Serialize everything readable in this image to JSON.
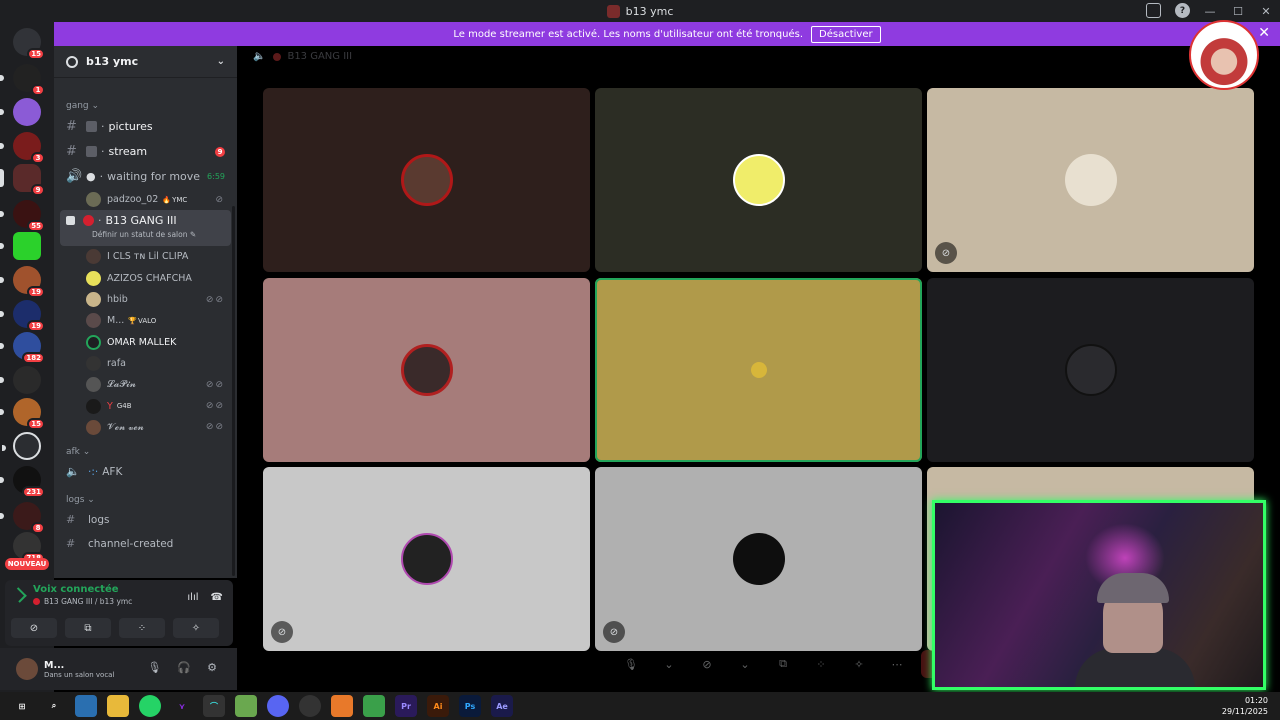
{
  "window": {
    "title": "b13 ymc"
  },
  "banner": {
    "message": "Le mode streamer est activé. Les noms d'utilisateur ont été tronqués.",
    "button_label": "Désactiver"
  },
  "rail": {
    "home_badge": "15",
    "badges": [
      "1",
      "",
      "3",
      "9",
      "55",
      "",
      "19",
      "19",
      "182",
      "",
      "15",
      "",
      "231",
      "8",
      "718"
    ],
    "nouveau_label": "NOUVEAU"
  },
  "sidebar": {
    "server_name": "b13 ymc",
    "category_gang": "gang",
    "channels": [
      {
        "name": "pictures"
      },
      {
        "name": "stream",
        "mention": "9"
      },
      {
        "name": "waiting for move",
        "timer": "6:59"
      }
    ],
    "waiting_member": {
      "name": "padzoo_02",
      "tag": "YMC"
    },
    "active_channel": {
      "name": "B13 GANG III",
      "status_hint": "Définir un statut de salon"
    },
    "members": [
      {
        "name": "I CLS ᴛɴ Lil CLIPA"
      },
      {
        "name": "AZIZOS CHAFCHA"
      },
      {
        "name": "hbib"
      },
      {
        "name": "M...",
        "tag": "VALO"
      },
      {
        "name": "OMAR MALLEK"
      },
      {
        "name": "rafa"
      },
      {
        "name": "𝓛𝓪𝓟𝓲𝓷"
      },
      {
        "name": "Y",
        "tag": "G4B"
      },
      {
        "name": "𝓥𝓮𝓷 𝓿𝓮𝓷"
      }
    ],
    "category_afk": "afk",
    "afk_channel": "AFK",
    "category_logs": "logs",
    "log_channels": [
      "logs",
      "channel-created"
    ]
  },
  "voice_panel": {
    "title": "Voix connectée",
    "subtitle": "B13 GANG III / b13 ymc"
  },
  "user": {
    "name": "M...",
    "status": "Dans un salon vocal"
  },
  "stage": {
    "channel_name": "B13 GANG III"
  },
  "taskbar": {
    "time": "01:20",
    "date": "29/11/2025"
  },
  "colors": {
    "banner": "#8f3be0",
    "online_green": "#23a55a",
    "danger_red": "#f23f43",
    "webcam_border": "#33ff66"
  }
}
